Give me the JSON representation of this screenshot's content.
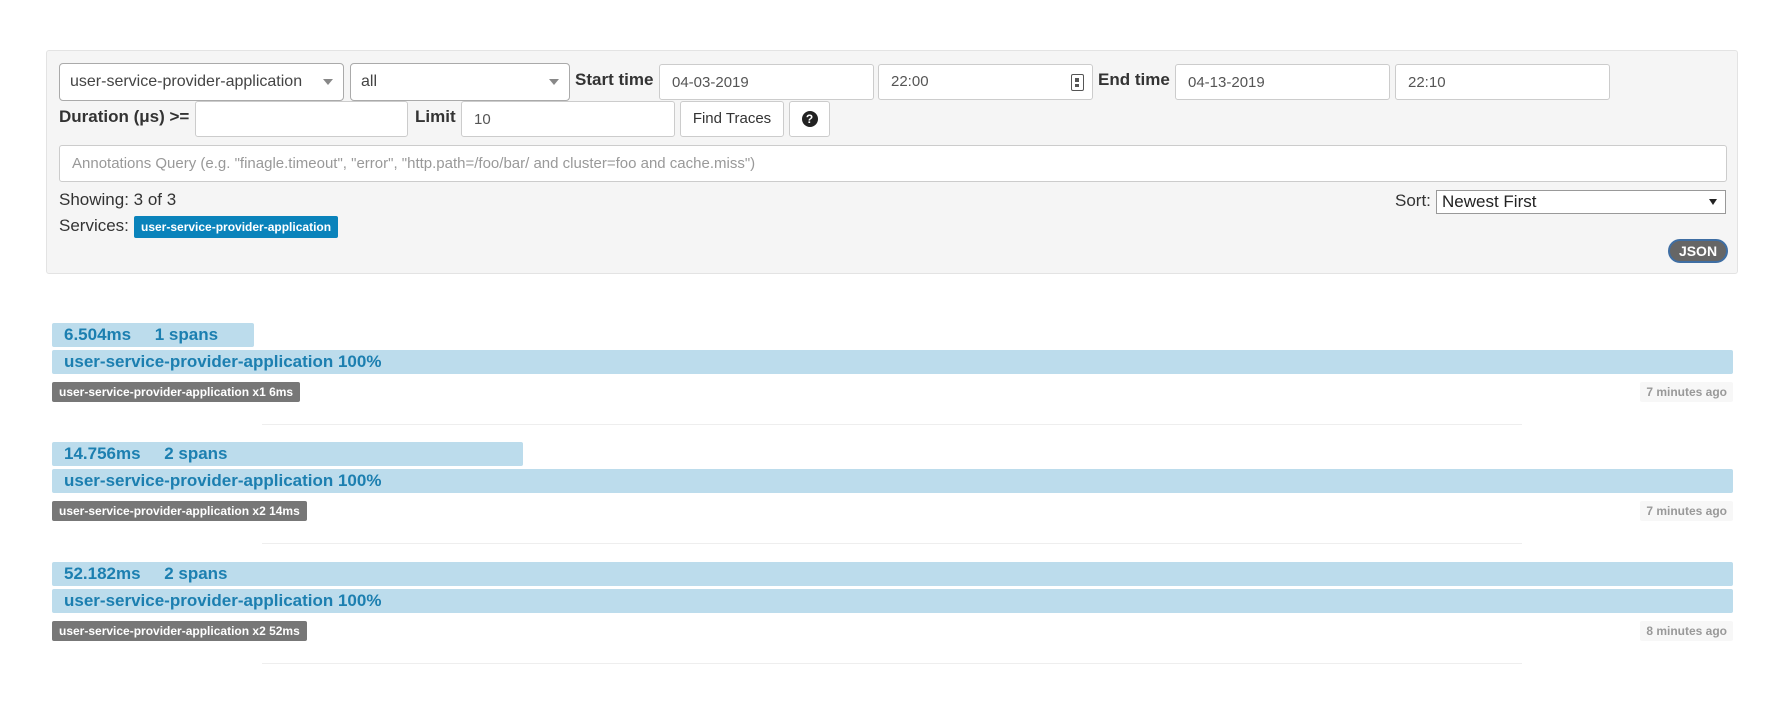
{
  "filters": {
    "service": "user-service-provider-application",
    "span": "all",
    "start_time_label": "Start time",
    "start_date": "04-03-2019",
    "start_time": "22:00",
    "end_time_label": "End time",
    "end_date": "04-13-2019",
    "end_time": "22:10",
    "duration_label": "Duration (μs) >=",
    "duration_value": "",
    "limit_label": "Limit",
    "limit_value": "10",
    "find_button": "Find Traces",
    "help_icon_glyph": "?",
    "annotations_placeholder": "Annotations Query (e.g. \"finagle.timeout\", \"error\", \"http.path=/foo/bar/ and cluster=foo and cache.miss\")"
  },
  "results": {
    "showing": "Showing: 3 of 3",
    "services_label": "Services:",
    "service_badge": "user-service-provider-application",
    "sort_label": "Sort:",
    "sort_value": "Newest First",
    "json_button": "JSON"
  },
  "traces": [
    {
      "duration": "6.504ms",
      "spans": "1 spans",
      "service_line": "user-service-provider-application 100%",
      "tag": "user-service-provider-application x1 6ms",
      "ago": "7 minutes ago",
      "duration_fraction": 0.12
    },
    {
      "duration": "14.756ms",
      "spans": "2 spans",
      "service_line": "user-service-provider-application 100%",
      "tag": "user-service-provider-application x2 14ms",
      "ago": "7 minutes ago",
      "duration_fraction": 0.28
    },
    {
      "duration": "52.182ms",
      "spans": "2 spans",
      "service_line": "user-service-provider-application 100%",
      "tag": "user-service-provider-application x2 52ms",
      "ago": "8 minutes ago",
      "duration_fraction": 1.0
    }
  ],
  "colors": {
    "accent": "#0a83bb",
    "bar": "#bcdcec",
    "bar_text": "#1c7fb0",
    "tag_bg": "#777777"
  }
}
